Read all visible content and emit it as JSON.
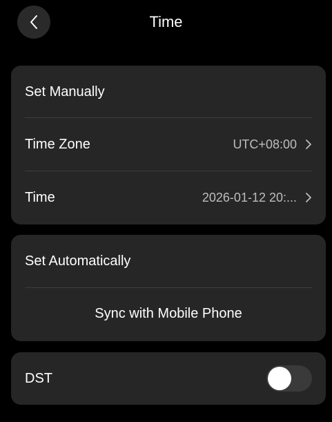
{
  "header": {
    "title": "Time",
    "back_icon": "chevron-left-icon"
  },
  "manual": {
    "heading": "Set Manually",
    "time_zone": {
      "label": "Time Zone",
      "value": "UTC+08:00",
      "icon": "chevron-right-icon"
    },
    "time": {
      "label": "Time",
      "value": "2026-01-12 20:...",
      "icon": "chevron-right-icon"
    }
  },
  "auto": {
    "heading": "Set Automatically",
    "sync_label": "Sync with Mobile Phone"
  },
  "dst": {
    "label": "DST",
    "enabled": false
  },
  "colors": {
    "background": "#000000",
    "card": "#262626",
    "divider": "#3d3d3d",
    "secondary_text": "#bdbdbd",
    "toggle_off": "#3a3a3a"
  }
}
